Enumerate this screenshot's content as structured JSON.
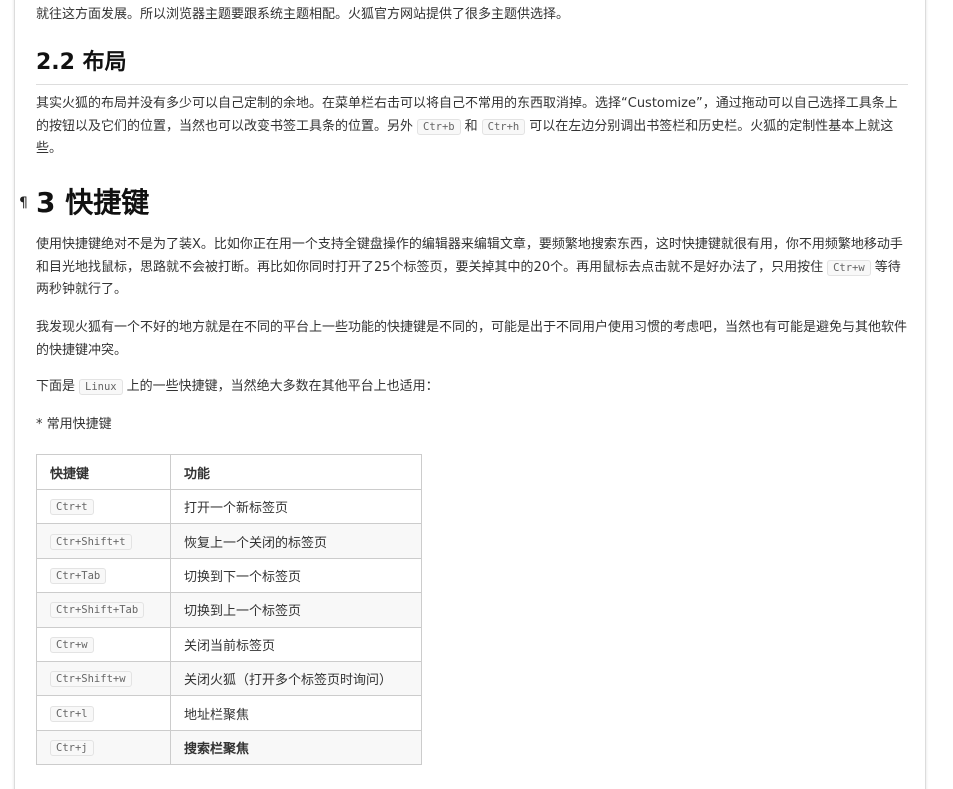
{
  "intro_text": "就往这方面发展。所以浏览器主题要跟系统主题相配。火狐官方网站提供了很多主题供选择。",
  "section_layout": {
    "heading": "2.2 布局",
    "text_part1": "其实火狐的布局并没有多少可以自己定制的余地。在菜单栏右击可以将自己不常用的东西取消掉。选择“Customize”，通过拖动可以自己选择工具条上的按钮以及它们的位置，当然也可以改变书签工具条的位置。另外",
    "code1": "Ctr+b",
    "text_part2": "和",
    "code2": "Ctr+h",
    "text_part3": "可以在左边分别调出书签栏和历史栏。火狐的定制性基本上就这些。"
  },
  "section_shortcuts": {
    "pilcrow": "¶",
    "heading": "3 快捷键",
    "p1_part1": "使用快捷键绝对不是为了装X。比如你正在用一个支持全键盘操作的编辑器来编辑文章，要频繁地搜索东西，这时快捷键就很有用，你不用频繁地移动手和目光地找鼠标，思路就不会被打断。再比如你同时打开了25个标签页，要关掉其中的20个。再用鼠标去点击就不是好办法了，只用按住",
    "p1_code": "Ctr+w",
    "p1_part2": "等待两秒钟就行了。",
    "p2": "我发现火狐有一个不好的地方就是在不同的平台上一些功能的快捷键是不同的，可能是出于不同用户使用习惯的考虑吧，当然也有可能是避免与其他软件的快捷键冲突。",
    "p3_part1": "下面是",
    "p3_code": "Linux",
    "p3_part2": "上的一些快捷键，当然绝大多数在其他平台上也适用：",
    "p4": "* 常用快捷键"
  },
  "shortcut_table": {
    "headers": [
      "快捷键",
      "功能"
    ],
    "rows": [
      {
        "key": "Ctr+t",
        "action": "打开一个新标签页"
      },
      {
        "key": "Ctr+Shift+t",
        "action": "恢复上一个关闭的标签页"
      },
      {
        "key": "Ctr+Tab",
        "action": "切换到下一个标签页"
      },
      {
        "key": "Ctr+Shift+Tab",
        "action": "切换到上一个标签页"
      },
      {
        "key": "Ctr+w",
        "action": "关闭当前标签页"
      },
      {
        "key": "Ctr+Shift+w",
        "action": "关闭火狐（打开多个标签页时询问）"
      },
      {
        "key": "Ctr+l",
        "action": "地址栏聚焦"
      },
      {
        "key": "Ctr+j",
        "action": "搜索栏聚焦"
      }
    ]
  }
}
